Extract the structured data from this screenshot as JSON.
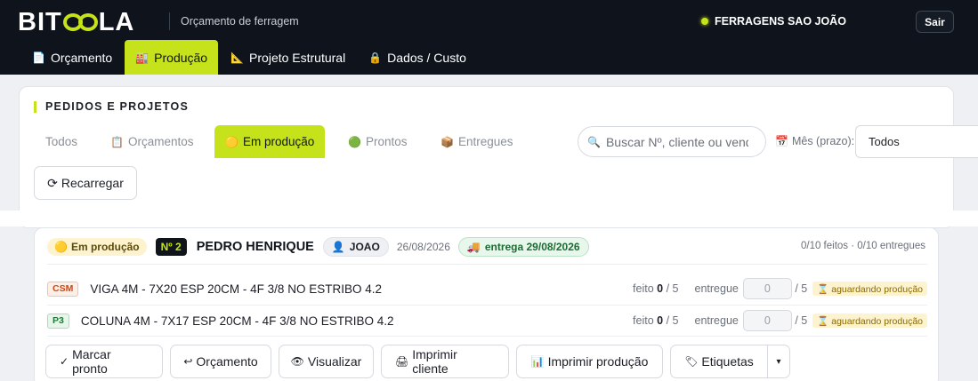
{
  "header": {
    "logo_left": "BIT",
    "logo_right": "LA",
    "subtitle": "Orçamento de ferragem",
    "company": "FERRAGENS SAO JOÃO",
    "logout": "Sair"
  },
  "nav": {
    "tabs": [
      {
        "label": "Orçamento",
        "icon": "document-icon",
        "glyph": "📄",
        "active": false
      },
      {
        "label": "Produção",
        "icon": "factory-icon",
        "glyph": "🏭",
        "active": true
      },
      {
        "label": "Projeto Estrutural",
        "icon": "triangle-ruler-icon",
        "glyph": "📐",
        "active": false
      },
      {
        "label": "Dados / Custo",
        "icon": "lock-icon",
        "glyph": "🔒",
        "active": false
      }
    ]
  },
  "panel": {
    "title": "PEDIDOS E PROJETOS",
    "filters": [
      {
        "label": "Todos",
        "glyph": "",
        "active": false
      },
      {
        "label": "Orçamentos",
        "icon": "clipboard-icon",
        "glyph": "📋",
        "active": false
      },
      {
        "label": "Em produção",
        "icon": "yellow-circle-icon",
        "glyph": "🟡",
        "active": true
      },
      {
        "label": "Prontos",
        "icon": "green-circle-icon",
        "glyph": "🟢",
        "active": false
      },
      {
        "label": "Entregues",
        "icon": "package-icon",
        "glyph": "📦",
        "active": false
      }
    ],
    "search_placeholder": "Buscar Nº, cliente ou vendedor",
    "month_label": "Mês (prazo):",
    "month_value": "Todos",
    "reload_label": "Recarregar",
    "reload_glyph": "⟳"
  },
  "order": {
    "status": "Em produção",
    "status_glyph": "🟡",
    "number": "Nº 2",
    "client": "PEDRO HENRIQUE",
    "seller": "JOAO",
    "seller_glyph": "👤",
    "date": "26/08/2026",
    "delivery": "entrega 29/08/2026",
    "delivery_glyph": "🚚",
    "counts": "0/10 feitos · 0/10 entregues",
    "items": [
      {
        "code": "CSM",
        "desc": "VIGA 4M - 7X20 ESP 20CM - 4F 3/8 NO ESTRIBO 4.2",
        "feito_label": "feito",
        "done": "0",
        "total": "/ 5",
        "entregue_label": "entregue",
        "delivered": "0",
        "total2": "/ 5",
        "status": "⌛ aguardando produção"
      },
      {
        "code": "P3",
        "desc": "COLUNA 4M - 7X17 ESP 20CM - 4F 3/8 NO ESTRIBO 4.2",
        "feito_label": "feito",
        "done": "0",
        "total": "/ 5",
        "entregue_label": "entregue",
        "delivered": "0",
        "total2": "/ 5",
        "status": "⌛ aguardando produção"
      }
    ],
    "actions": {
      "mark_ready": "Marcar pronto",
      "mark_ready_glyph": "✓",
      "budget": "Orçamento",
      "budget_glyph": "↩",
      "view": "Visualizar",
      "view_glyph": "👁",
      "print_client": "Imprimir cliente",
      "print_client_glyph": "🖨",
      "print_production": "Imprimir produção",
      "print_production_glyph": "📊",
      "labels": "Etiquetas",
      "labels_glyph": "🏷",
      "more_glyph": "▾"
    }
  }
}
